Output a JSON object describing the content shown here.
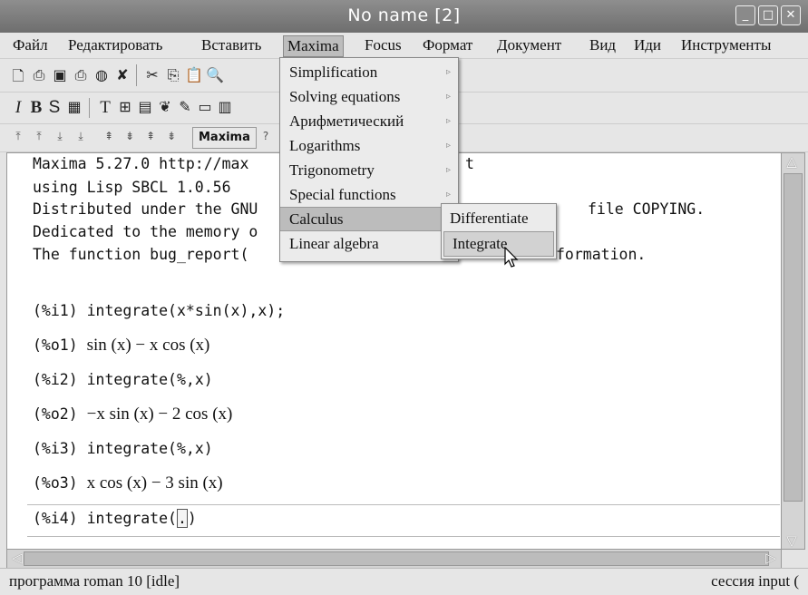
{
  "window": {
    "title": "No name [2]",
    "controls": [
      "_",
      "□",
      "✕"
    ]
  },
  "menubar": [
    "Файл",
    "Редактировать",
    "Вставить",
    "Maxima",
    "Focus",
    "Формат",
    "Документ",
    "Вид",
    "Иди",
    "Инструменты"
  ],
  "toolbar3": {
    "maxima_label": "Maxima"
  },
  "document": {
    "header_lines": [
      "Maxima 5.27.0 http://max",
      "using Lisp SBCL 1.0.56",
      "Distributed under the GNU",
      "Dedicated to the memory o",
      "The function bug_report("
    ],
    "header_right_fragments": [
      "t",
      "file COPYING.",
      "formation."
    ],
    "cells": [
      {
        "input_label": "(%i1)",
        "input": "integrate(x*sin(x),x);",
        "output_label": "(%o1)",
        "output": "sin (x) − x cos (x)"
      },
      {
        "input_label": "(%i2)",
        "input": "integrate(%,x)",
        "output_label": "(%o2)",
        "output": "−x sin (x) − 2 cos (x)"
      },
      {
        "input_label": "(%i3)",
        "input": "integrate(%,x)",
        "output_label": "(%o3)",
        "output": "x cos (x) − 3 sin (x)"
      }
    ],
    "current": {
      "label": "(%i4)",
      "input": "integrate(",
      "selection": ".",
      "close": ")"
    }
  },
  "maxima_menu": {
    "items": [
      {
        "label": "Simplification",
        "submenu": true
      },
      {
        "label": "Solving equations",
        "submenu": true
      },
      {
        "label": "Арифметический",
        "submenu": true
      },
      {
        "label": "Logarithms",
        "submenu": true
      },
      {
        "label": "Trigonometry",
        "submenu": true
      },
      {
        "label": "Special functions",
        "submenu": true
      },
      {
        "label": "Calculus",
        "submenu": true,
        "highlighted": true
      },
      {
        "label": "Linear algebra",
        "submenu": true
      }
    ],
    "submenu_arrow": "▹"
  },
  "calculus_submenu": {
    "items": [
      {
        "label": "Differentiate"
      },
      {
        "label": "Integrate",
        "highlighted": true
      }
    ]
  },
  "statusbar": {
    "left": "программа roman 10 [idle]",
    "right": "сессия input ("
  },
  "colors": {
    "title_bar": "#7a7a7a",
    "menu_bg": "#ebebeb",
    "highlight": "#bcbcbc"
  }
}
